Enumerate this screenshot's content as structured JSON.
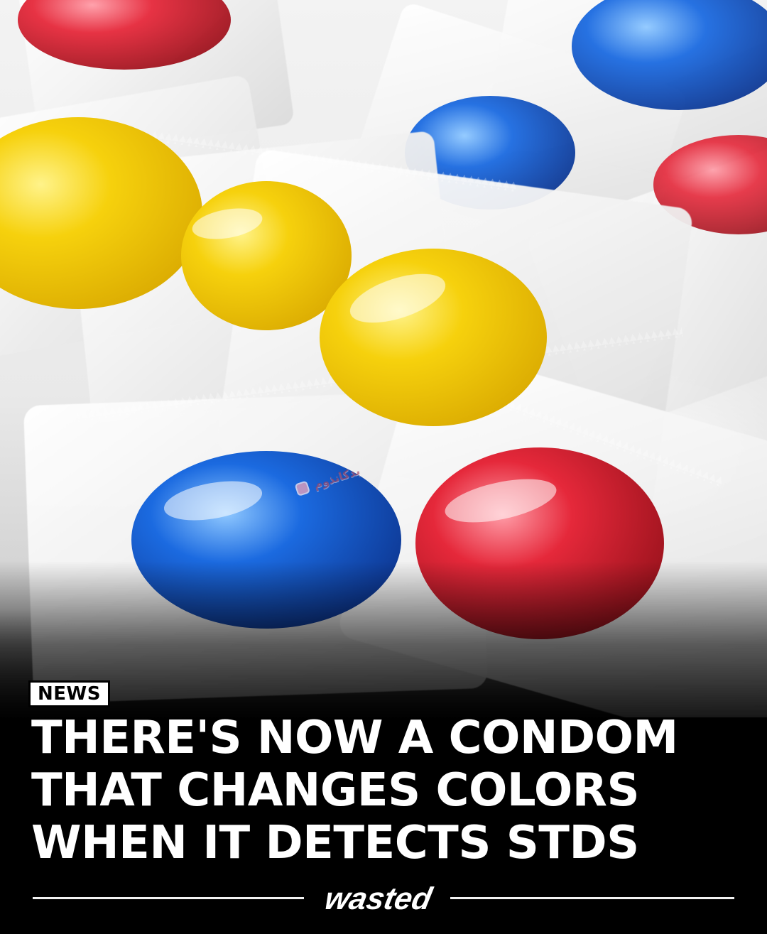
{
  "post": {
    "tag": "NEWS",
    "headline_lines": [
      "THERE'S NOW A CONDOM",
      "THAT CHANGES COLORS",
      "WHEN IT DETECTS STDS"
    ],
    "brand": "wasted",
    "watermark_text": "بدکانذوم"
  },
  "colors": {
    "background": "#000000",
    "headline_text": "#FFFFFF",
    "tag_background": "#FFFFFF",
    "tag_text": "#000000",
    "accent_yellow": "#F6D10D",
    "accent_blue": "#1556C8",
    "accent_red": "#D81E2C"
  },
  "icons": {
    "watermark": "badge-icon"
  }
}
